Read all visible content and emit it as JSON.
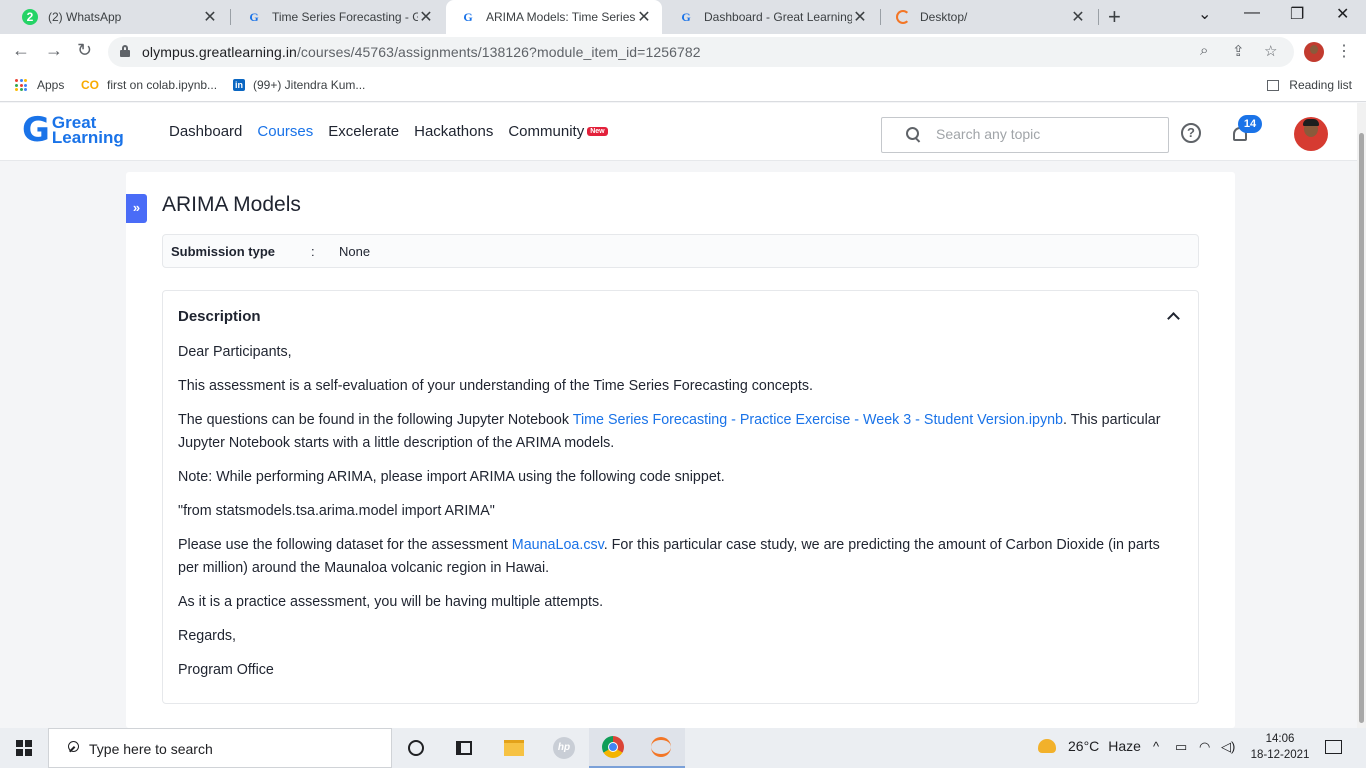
{
  "browser": {
    "tabs": [
      {
        "title": "(2) WhatsApp",
        "favicon": "whatsapp-icon",
        "favicon_text": "2"
      },
      {
        "title": "Time Series Forecasting - Great Learning",
        "favicon": "google-g-icon",
        "favicon_text": "G"
      },
      {
        "title": "ARIMA Models: Time Series Forecasting",
        "favicon": "google-g-icon",
        "favicon_text": "G",
        "active": true
      },
      {
        "title": "Dashboard - Great Learning",
        "favicon": "google-g-icon",
        "favicon_text": "G"
      },
      {
        "title": "Desktop/",
        "favicon": "jupyter-icon",
        "favicon_text": ""
      }
    ],
    "tab_close_glyph": "✕",
    "new_tab_glyph": "+",
    "url_host": "olympus.greatlearning.in",
    "url_path": "/courses/45763/assignments/138126?module_item_id=1256782",
    "bookmarks": [
      {
        "label": "Apps",
        "icon": "apps-grid-icon"
      },
      {
        "label": "first on colab.ipynb...",
        "icon": "colab-icon",
        "icon_text": "CO"
      },
      {
        "label": "(99+) Jitendra Kum...",
        "icon": "linkedin-icon",
        "icon_text": "in"
      }
    ],
    "reading_list": "Reading list"
  },
  "site": {
    "logo_text": "Great Learning",
    "logo_mark": "G",
    "logo_line1": "Great",
    "logo_line2": "Learning",
    "nav": [
      "Dashboard",
      "Courses",
      "Excelerate",
      "Hackathons",
      "Community"
    ],
    "active_nav": "Courses",
    "new_badge": "New",
    "search_placeholder": "Search any topic",
    "help_glyph": "?",
    "notification_count": "14",
    "accent_color": "#1a73e8"
  },
  "page": {
    "title": "ARIMA Models",
    "side_toggle": "»",
    "submission_label": "Submission type",
    "submission_colon": ":",
    "submission_value": "None",
    "description_heading": "Description",
    "greeting": "Dear Participants,",
    "p1": "This assessment is a self-evaluation of your understanding of the Time Series Forecasting concepts.",
    "p2_before": "The questions can be found in the following Jupyter Notebook ",
    "p2_link": "Time Series Forecasting - Practice Exercise - Week 3 - Student Version.ipynb",
    "p2_after": ". This particular Jupyter Notebook starts with a little description of the ARIMA models.",
    "p3": "Note: While performing ARIMA, please import ARIMA using the following code snippet.",
    "p4": "\"from statsmodels.tsa.arima.model import ARIMA\"",
    "p5_before": "Please use the following dataset for the assessment ",
    "p5_link": "MaunaLoa.csv",
    "p5_after": ". For this particular case study, we are predicting the amount of Carbon Dioxide (in parts per million) around the Maunaloa volcanic region in Hawai.",
    "p6": "As it is a practice assessment, you will be having multiple attempts.",
    "p7": "Regards,",
    "p8": "Program Office"
  },
  "taskbar": {
    "search_placeholder": "Type here to search",
    "hp_text": "hp",
    "weather_temp": "26°C",
    "weather_cond": "Haze",
    "tray_up": "^",
    "time": "14:06",
    "date": "18-12-2021"
  }
}
